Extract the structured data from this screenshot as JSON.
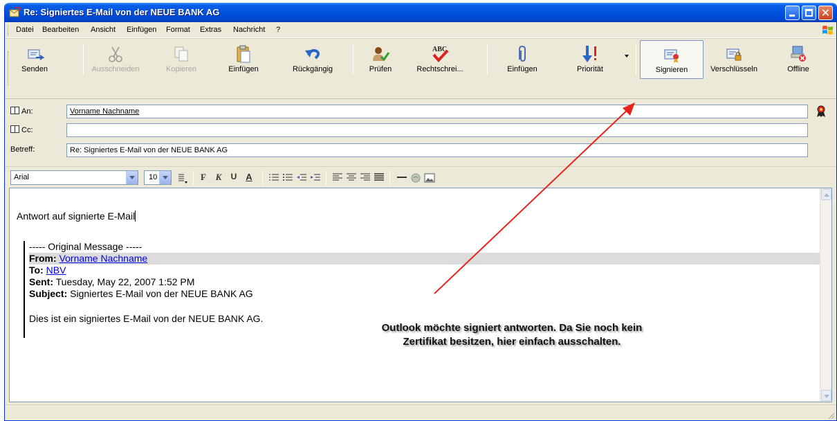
{
  "window": {
    "title": "Re: Signiertes E-Mail von der NEUE BANK AG"
  },
  "menu": [
    "Datei",
    "Bearbeiten",
    "Ansicht",
    "Einfügen",
    "Format",
    "Extras",
    "Nachricht",
    "?"
  ],
  "toolbar": {
    "send": "Senden",
    "cut": "Ausschneiden",
    "copy": "Kopieren",
    "paste": "Einfügen",
    "undo": "Rückgängig",
    "check": "Prüfen",
    "spelling": "Rechtschrei...",
    "attach": "Einfügen",
    "priority": "Priorität",
    "sign": "Signieren",
    "encrypt": "Verschlüsseln",
    "offline": "Offline"
  },
  "headers": {
    "to_label": "An:",
    "to_value": "Vorname Nachname",
    "cc_label": "Cc:",
    "cc_value": "",
    "subject_label": "Betreff:",
    "subject_value": "Re: Signiertes E-Mail von der NEUE BANK AG"
  },
  "format": {
    "font": "Arial",
    "size": "10",
    "bold": "F",
    "italic": "K",
    "underline": "U",
    "color": "A"
  },
  "body": {
    "reply": "Antwort auf signierte E-Mail",
    "original_header": "----- Original Message -----",
    "from_label": "From:",
    "from_value": "Vorname Nachname",
    "to_label": "To:",
    "to_value": "NBV",
    "sent_label": "Sent:",
    "sent_value": "Tuesday, May 22, 2007 1:52 PM",
    "subject_label": "Subject:",
    "subject_value": "Signiertes E-Mail von der NEUE BANK AG",
    "original_text": "Dies ist ein signiertes E-Mail von der NEUE BANK AG."
  },
  "annotation": {
    "line1": "Outlook möchte signiert antworten. Da Sie noch kein",
    "line2": "Zertifikat besitzen, hier einfach ausschalten."
  },
  "colors": {
    "titlebar": "#0053e0",
    "arrow": "#e8231c",
    "link": "#0000ee"
  }
}
